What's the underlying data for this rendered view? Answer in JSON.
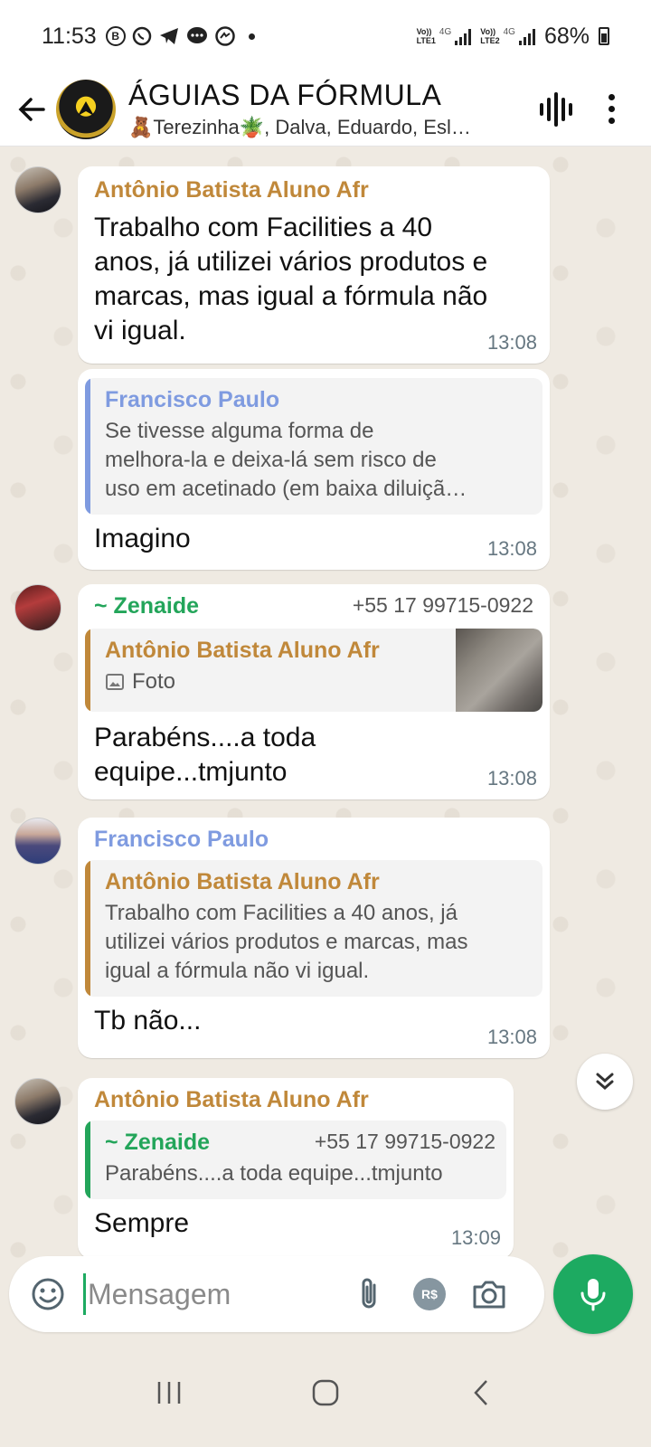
{
  "status_bar": {
    "time": "11:53",
    "app_icons": [
      "b-circle-icon",
      "whatsapp-icon",
      "telegram-icon",
      "chat-bubble-icon",
      "messenger-icon"
    ],
    "sim1_label_top": "Vo))",
    "sim1_label_bottom": "LTE1",
    "sim1_net": "4G",
    "sim2_label_top": "Vo))",
    "sim2_label_bottom": "LTE2",
    "sim2_net": "4G",
    "battery": "68%"
  },
  "header": {
    "group_name": "ÁGUIAS DA FÓRMULA",
    "members": "🧸Terezinha🪴, Dalva, Eduardo, Esl…"
  },
  "messages": [
    {
      "sender": "Antônio Batista Aluno Afr",
      "text_lines": [
        "Trabalho com Facilities a 40",
        "anos, já utilizei vários produtos e",
        "marcas, mas igual a fórmula não",
        "vi igual."
      ],
      "time": "13:08"
    },
    {
      "quote_name": "Francisco Paulo",
      "quote_lines": [
        "Se tivesse alguma forma de",
        "melhora-la e deixa-lá sem risco de",
        "uso em acetinado (em baixa diluiçã…"
      ],
      "text": "Imagino",
      "time": "13:08"
    },
    {
      "sender": "~ Zenaide",
      "phone": "+55 17 99715-0922",
      "quote_name": "Antônio Batista Aluno Afr",
      "quote_media": "Foto",
      "text_lines": [
        "Parabéns....a toda",
        "equipe...tmjunto"
      ],
      "time": "13:08"
    },
    {
      "sender": "Francisco Paulo",
      "quote_name": "Antônio Batista Aluno Afr",
      "quote_lines": [
        "Trabalho com Facilities a 40 anos, já",
        "utilizei vários produtos e marcas, mas",
        "igual a fórmula não vi igual."
      ],
      "text": "Tb não...",
      "time": "13:08"
    },
    {
      "sender": "Antônio Batista Aluno Afr",
      "quote_name": "~ Zenaide",
      "quote_phone": "+55 17 99715-0922",
      "quote_text": "Parabéns....a toda equipe...tmjunto",
      "text": "Sempre",
      "time": "13:09"
    }
  ],
  "composer": {
    "placeholder": "Mensagem",
    "payment_badge": "R$"
  },
  "colors": {
    "accent_green": "#1daa61",
    "antonio": "#c0883a",
    "francisco": "#7f9be0",
    "zenaide": "#23a55a",
    "chat_bg": "#efeae2"
  }
}
